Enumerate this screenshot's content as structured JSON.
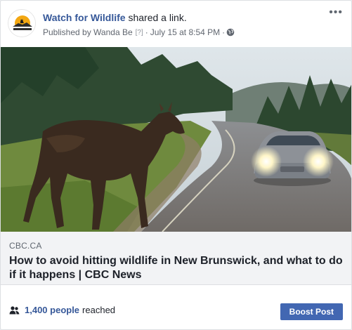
{
  "post": {
    "page_name": "Watch for Wildlife",
    "action": "shared a link.",
    "published_by": "Published by Wanda Be",
    "help_marker": "[?]",
    "separator": "·",
    "timestamp": "July 15 at 8:54 PM",
    "more_icon": "more-options-icon",
    "privacy_icon": "globe-icon"
  },
  "link": {
    "domain": "CBC.CA",
    "title": "How to avoid hitting wildlife in New Brunswick, and what to do if it happens | CBC News",
    "image": "moose-crossing-road-photo"
  },
  "footer": {
    "reach_count": "1,400 people",
    "reach_label": "reached",
    "boost_label": "Boost Post"
  },
  "colors": {
    "link_blue": "#365899",
    "boost_blue": "#4267b2",
    "muted_text": "#616770",
    "preview_bg": "#f2f3f5"
  }
}
